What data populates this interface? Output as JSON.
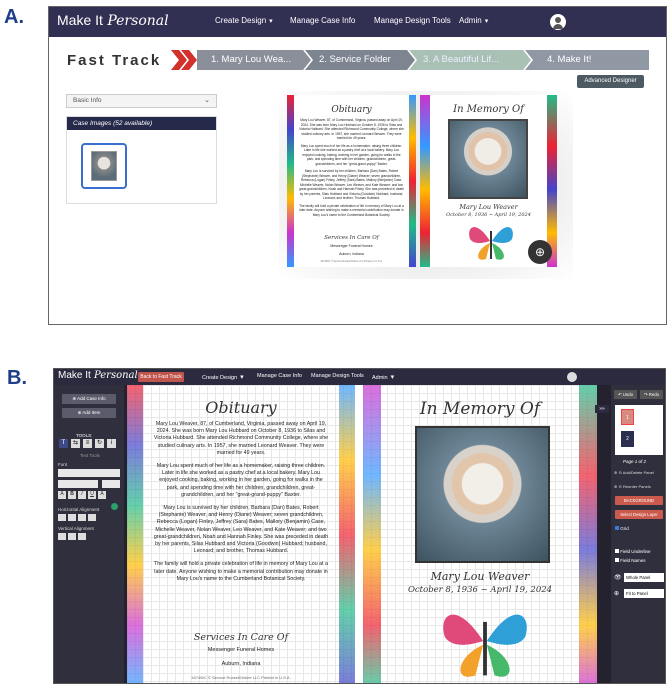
{
  "labels": {
    "a": "A.",
    "b": "B."
  },
  "nav": {
    "logo_make": "Make It",
    "logo_personal": "Personal",
    "create_design": "Create Design",
    "manage_case_info": "Manage Case Info",
    "manage_design_tools": "Manage Design Tools",
    "admin": "Admin",
    "caret": "▾"
  },
  "fast_track": {
    "title": "Fast Track",
    "steps": [
      "1. Mary Lou Wea...",
      "2. Service Folder",
      "3. A Beautiful Lif...",
      "4. Make It!"
    ],
    "advanced_designer": "Advanced Designer",
    "basic_info": "Basic Info",
    "case_images": "Case Images (52 available)"
  },
  "obituary": {
    "heading": "Obituary",
    "paragraphs": [
      "Mary Lou Weaver, 87, of Cumberland, Virginia, passed away on April 19, 2024. She was born Mary Lou Hubbard on October 8, 1936 to Silas and Victoria Hubbard. She attended Richmond Community College, where she studied culinary arts. In 1957, she married Leonard Weaver. They were married for 49 years.",
      "Mary Lou spent much of her life as a homemaker, raising three children. Later in life she worked as a pastry chef at a local bakery. Mary Lou enjoyed cooking, baking, working in her garden, going for walks in the park, and spending time with her children, grandchildren, great-grandchildren, and her \"great-grand-puppy\" Baxter.",
      "Mary Lou is survived by her children, Barbara (Dan) Bates, Robert (Stephanie) Weaver, and Henry (Diane) Weaver; seven grandchildren, Rebecca (Logan) Finley, Jeffrey (Sara) Bates, Mallory (Benjamin) Case, Michelle Weaver, Nolan Weaver, Leo Weaver, and Kate Weaver; and two great-grandchildren, Noah and Hannah Finley. She was preceded in death by her parents, Silas Hubbard and Victoria (Goodwin) Hubbard; husband, Leonard; and brother, Thomas Hubbard.",
      "The family will hold a private celebration of life in memory of Mary Lou at a later date. Anyone wishing to make a memorial contribution may donate in Mary Lou's name to the Cumberland Botanical Society."
    ],
    "services": "Services In Care Of",
    "funeral_home": "Messenger Funeral Homes",
    "city": "Auburn, Indiana",
    "footer": "1674WC  © Service Rocket/Online LLC  Printed in U.S.A."
  },
  "memory": {
    "heading": "In Memory Of",
    "name": "Mary Lou Weaver",
    "dates": "October 8, 1936 ~ April 19, 2024"
  },
  "left_panel": {
    "add_case_info": "Add Case Info",
    "add_item": "Add Item",
    "tools": "TOOLS:",
    "text_tools": "Text Tools",
    "font": "Font",
    "horizontal_alignment": "Horizontal Alignment",
    "vertical_alignment": "Vertical Alignment"
  },
  "right_panel": {
    "undo": "Undo",
    "redo": "Redo",
    "page1": "1",
    "page2": "2",
    "page_of": "Page 1 of 2",
    "add_delete_panel": "Add/Delete Panel",
    "reorder_panels": "Reorder Panels",
    "background": "BACKGROUND",
    "select_design_layer": "Select Design Layer",
    "grid": "Grid",
    "field_underline": "Field Underline",
    "field_names": "Field Names",
    "view_select": "Whole Panel",
    "fit_select": "Fit to Panel"
  },
  "colors": {
    "nav": "#312f52",
    "accent_red": "#c95a4c",
    "step1": "#8a8f99",
    "step2": "#7d8591",
    "step3": "#a9c0b4",
    "step4": "#9098a4"
  }
}
